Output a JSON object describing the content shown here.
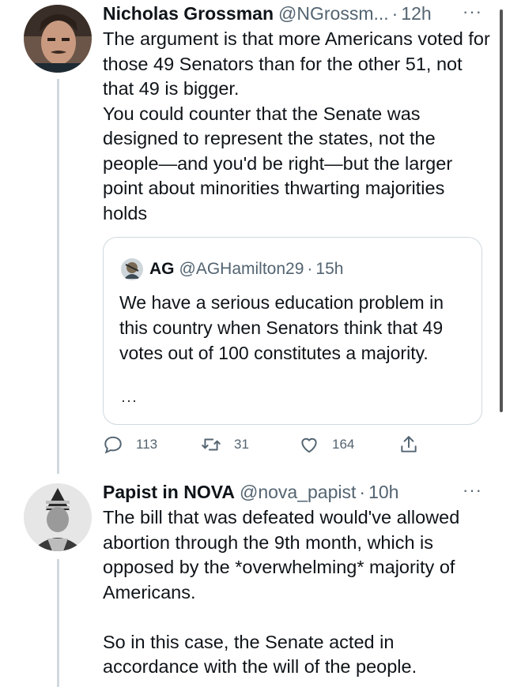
{
  "tweet1": {
    "name": "Nicholas Grossman",
    "handle": "@NGrossm...",
    "separator": "·",
    "time": "12h",
    "more": "···",
    "text": "The argument is that more Americans voted for those 49 Senators than for the other 51, not that 49 is bigger.\nYou could counter that the Senate was designed to represent the states, not the people—and you'd be right—but the larger point about minorities thwarting majorities holds",
    "quote": {
      "name": "AG",
      "handle": "@AGHamilton29",
      "separator": "·",
      "time": "15h",
      "text": "We have a serious education problem in this country when Senators think that 49 votes out of 100 constitutes a majority.",
      "more": "···"
    },
    "actions": {
      "reply_count": "113",
      "retweet_count": "31",
      "like_count": "164",
      "reply_icon": "reply-icon",
      "retweet_icon": "retweet-icon",
      "like_icon": "like-icon",
      "share_icon": "share-icon"
    }
  },
  "tweet2": {
    "name": "Papist in NOVA",
    "handle": "@nova_papist",
    "separator": "·",
    "time": "10h",
    "more": "···",
    "text": "The bill that was defeated would've allowed abortion through the 9th month, which is opposed by the *overwhelming* majority of Americans.\n\nSo in this case, the Senate acted in accordance with the will of the people."
  },
  "colors": {
    "text": "#0f1419",
    "secondary": "#536471",
    "border": "#cfd9de",
    "thread_line": "#cfd9de"
  }
}
